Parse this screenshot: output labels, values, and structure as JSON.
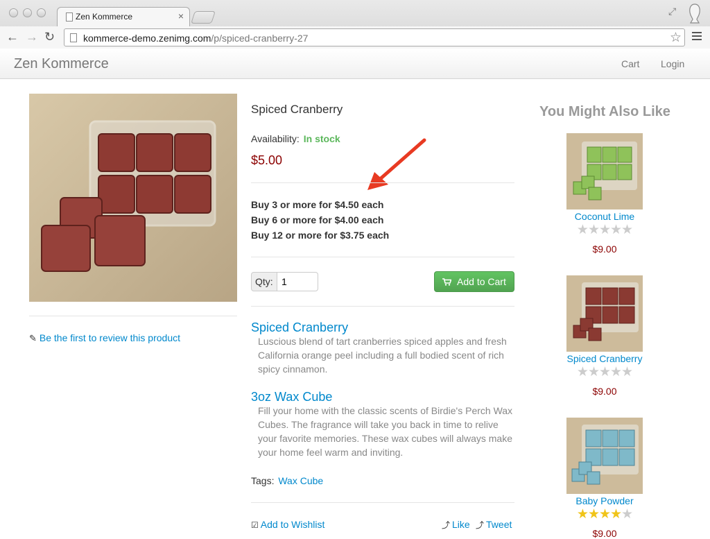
{
  "browser": {
    "tab_title": "Zen Kommerce",
    "tab_close": "×",
    "url_host": "kommerce-demo.zenimg.com",
    "url_path": "/p/spiced-cranberry-27"
  },
  "navbar": {
    "brand": "Zen Kommerce",
    "cart": "Cart",
    "login": "Login"
  },
  "product": {
    "title": "Spiced Cranberry",
    "availability_label": "Availability:",
    "availability_value": "In stock",
    "price": "$5.00",
    "tiers": [
      "Buy 3 or more for $4.50 each",
      "Buy 6 or more for $4.00 each",
      "Buy 12 or more for $3.75 each"
    ],
    "qty_label": "Qty:",
    "qty_value": "1",
    "add_to_cart": "Add to Cart",
    "review_link": "Be the first to review this product",
    "sections": [
      {
        "title": "Spiced Cranberry",
        "body": "Luscious blend of tart cranberries spiced apples and fresh California orange peel including a full bodied scent of rich spicy cinnamon."
      },
      {
        "title": "3oz Wax Cube",
        "body": "Fill your home with the classic scents of Birdie's Perch Wax Cubes. The fragrance will take you back in time to relive your favorite memories. These wax cubes will always make your home feel warm and inviting."
      }
    ],
    "tags_label": "Tags:",
    "tag": "Wax Cube",
    "wishlist": "Add to Wishlist",
    "like": "Like",
    "tweet": "Tweet"
  },
  "suggestions": {
    "title": "You Might Also Like",
    "items": [
      {
        "name": "Coconut Lime",
        "price": "$9.00",
        "rating": 0,
        "color": "#8fc25a"
      },
      {
        "name": "Spiced Cranberry",
        "price": "$9.00",
        "rating": 0,
        "color": "#8a3a32"
      },
      {
        "name": "Baby Powder",
        "price": "$9.00",
        "rating": 4,
        "color": "#7fb9c9"
      }
    ]
  },
  "colors": {
    "link": "#0088cc",
    "price": "#8b0000",
    "stock": "#5bb75b",
    "cart_button": "#5bb75b",
    "annotation_arrow": "#e83a22"
  },
  "icons": {
    "pencil": "✎",
    "cart": "🛒",
    "check": "☑",
    "share": "⤴"
  }
}
